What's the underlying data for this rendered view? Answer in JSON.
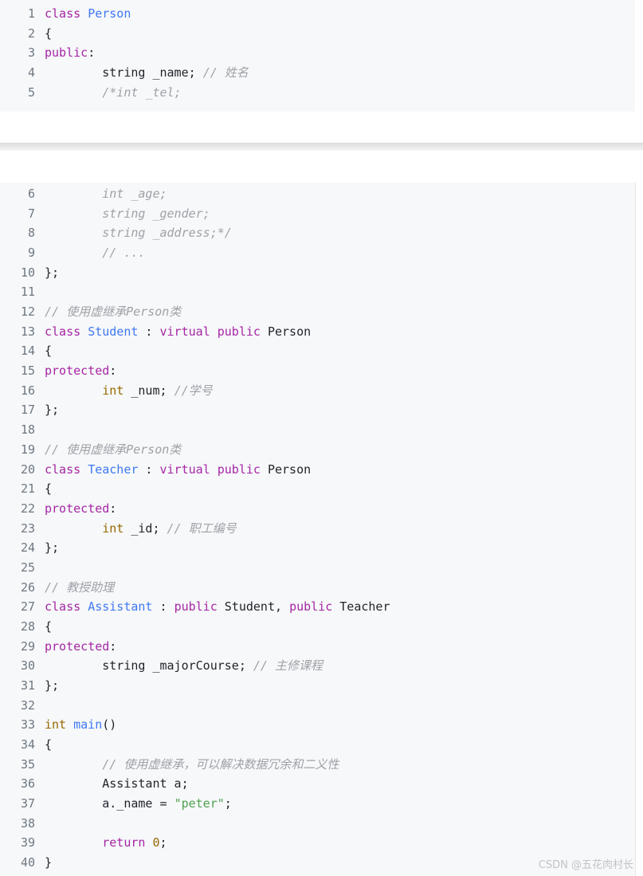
{
  "watermark": "CSDN @五花肉村长",
  "block1": [
    {
      "n": "1",
      "t": [
        [
          "kw",
          "class"
        ],
        [
          "p",
          " "
        ],
        [
          "cls",
          "Person"
        ]
      ]
    },
    {
      "n": "2",
      "t": [
        [
          "p",
          "{"
        ]
      ]
    },
    {
      "n": "3",
      "t": [
        [
          "kw",
          "public"
        ],
        [
          "p",
          ":"
        ]
      ]
    },
    {
      "n": "4",
      "t": [
        [
          "p",
          "        string _name; "
        ],
        [
          "cm",
          "// 姓名"
        ]
      ]
    },
    {
      "n": "5",
      "t": [
        [
          "cm",
          "        /*int _tel;"
        ]
      ]
    }
  ],
  "block2": [
    {
      "n": "6",
      "t": [
        [
          "cm",
          "        int _age;"
        ]
      ]
    },
    {
      "n": "7",
      "t": [
        [
          "cm",
          "        string _gender;"
        ]
      ]
    },
    {
      "n": "8",
      "t": [
        [
          "cm",
          "        string _address;*/"
        ]
      ]
    },
    {
      "n": "9",
      "t": [
        [
          "cm",
          "        // ..."
        ]
      ]
    },
    {
      "n": "10",
      "t": [
        [
          "p",
          "};"
        ]
      ]
    },
    {
      "n": "11",
      "t": []
    },
    {
      "n": "12",
      "t": [
        [
          "cm",
          "// 使用虚继承Person类"
        ]
      ]
    },
    {
      "n": "13",
      "t": [
        [
          "kw",
          "class"
        ],
        [
          "p",
          " "
        ],
        [
          "cls",
          "Student"
        ],
        [
          "p",
          " : "
        ],
        [
          "kw",
          "virtual"
        ],
        [
          "p",
          " "
        ],
        [
          "kw",
          "public"
        ],
        [
          "p",
          " Person"
        ]
      ]
    },
    {
      "n": "14",
      "t": [
        [
          "p",
          "{"
        ]
      ]
    },
    {
      "n": "15",
      "t": [
        [
          "kw",
          "protected"
        ],
        [
          "p",
          ":"
        ]
      ]
    },
    {
      "n": "16",
      "t": [
        [
          "p",
          "        "
        ],
        [
          "ty",
          "int"
        ],
        [
          "p",
          " _num; "
        ],
        [
          "cm",
          "//学号"
        ]
      ]
    },
    {
      "n": "17",
      "t": [
        [
          "p",
          "};"
        ]
      ]
    },
    {
      "n": "18",
      "t": []
    },
    {
      "n": "19",
      "t": [
        [
          "cm",
          "// 使用虚继承Person类"
        ]
      ]
    },
    {
      "n": "20",
      "t": [
        [
          "kw",
          "class"
        ],
        [
          "p",
          " "
        ],
        [
          "cls",
          "Teacher"
        ],
        [
          "p",
          " : "
        ],
        [
          "kw",
          "virtual"
        ],
        [
          "p",
          " "
        ],
        [
          "kw",
          "public"
        ],
        [
          "p",
          " Person"
        ]
      ]
    },
    {
      "n": "21",
      "t": [
        [
          "p",
          "{"
        ]
      ]
    },
    {
      "n": "22",
      "t": [
        [
          "kw",
          "protected"
        ],
        [
          "p",
          ":"
        ]
      ]
    },
    {
      "n": "23",
      "t": [
        [
          "p",
          "        "
        ],
        [
          "ty",
          "int"
        ],
        [
          "p",
          " _id; "
        ],
        [
          "cm",
          "// 职工编号"
        ]
      ]
    },
    {
      "n": "24",
      "t": [
        [
          "p",
          "};"
        ]
      ]
    },
    {
      "n": "25",
      "t": []
    },
    {
      "n": "26",
      "t": [
        [
          "cm",
          "// 教授助理"
        ]
      ]
    },
    {
      "n": "27",
      "t": [
        [
          "kw",
          "class"
        ],
        [
          "p",
          " "
        ],
        [
          "cls",
          "Assistant"
        ],
        [
          "p",
          " : "
        ],
        [
          "kw",
          "public"
        ],
        [
          "p",
          " Student, "
        ],
        [
          "kw",
          "public"
        ],
        [
          "p",
          " Teacher"
        ]
      ]
    },
    {
      "n": "28",
      "t": [
        [
          "p",
          "{"
        ]
      ]
    },
    {
      "n": "29",
      "t": [
        [
          "kw",
          "protected"
        ],
        [
          "p",
          ":"
        ]
      ]
    },
    {
      "n": "30",
      "t": [
        [
          "p",
          "        string _majorCourse; "
        ],
        [
          "cm",
          "// 主修课程"
        ]
      ]
    },
    {
      "n": "31",
      "t": [
        [
          "p",
          "};"
        ]
      ]
    },
    {
      "n": "32",
      "t": []
    },
    {
      "n": "33",
      "t": [
        [
          "ty",
          "int"
        ],
        [
          "p",
          " "
        ],
        [
          "cls",
          "main"
        ],
        [
          "p",
          "()"
        ]
      ]
    },
    {
      "n": "34",
      "t": [
        [
          "p",
          "{"
        ]
      ]
    },
    {
      "n": "35",
      "t": [
        [
          "cm",
          "        // 使用虚继承，可以解决数据冗余和二义性"
        ]
      ]
    },
    {
      "n": "36",
      "t": [
        [
          "p",
          "        Assistant a;"
        ]
      ]
    },
    {
      "n": "37",
      "t": [
        [
          "p",
          "        a._name = "
        ],
        [
          "str",
          "\"peter\""
        ],
        [
          "p",
          ";"
        ]
      ]
    },
    {
      "n": "38",
      "t": []
    },
    {
      "n": "39",
      "t": [
        [
          "p",
          "        "
        ],
        [
          "kw",
          "return"
        ],
        [
          "p",
          " "
        ],
        [
          "num",
          "0"
        ],
        [
          "p",
          ";"
        ]
      ]
    },
    {
      "n": "40",
      "t": [
        [
          "p",
          "}"
        ]
      ]
    }
  ]
}
